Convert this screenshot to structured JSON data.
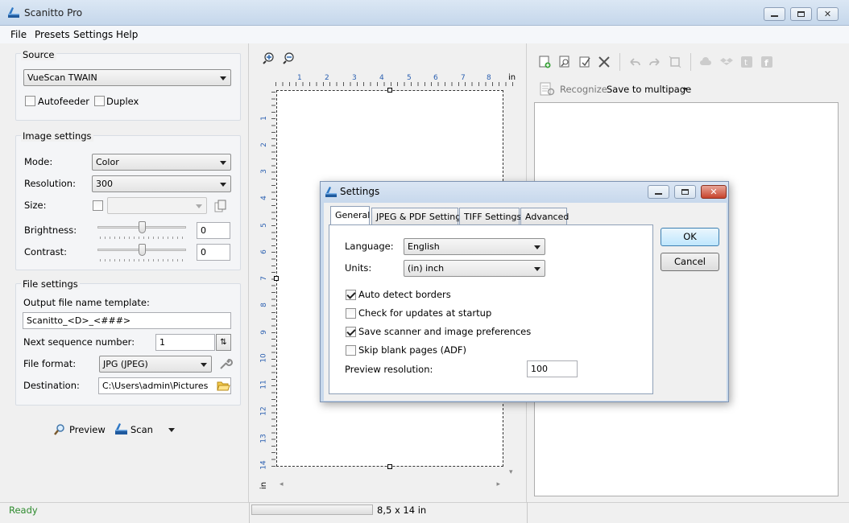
{
  "window": {
    "title": "Scanitto Pro"
  },
  "menu": [
    "File",
    "Presets",
    "Settings",
    "Help"
  ],
  "source": {
    "group_label": "Source",
    "device": "VueScan TWAIN",
    "autofeeder_label": "Autofeeder",
    "duplex_label": "Duplex"
  },
  "image_settings": {
    "group_label": "Image settings",
    "mode_label": "Mode:",
    "mode_value": "Color",
    "resolution_label": "Resolution:",
    "resolution_value": "300",
    "size_label": "Size:",
    "size_value": "",
    "brightness_label": "Brightness:",
    "brightness_value": "0",
    "contrast_label": "Contrast:",
    "contrast_value": "0"
  },
  "file_settings": {
    "group_label": "File settings",
    "template_label": "Output file name template:",
    "template_value": "Scanitto_<D>_<###>",
    "sequence_label": "Next sequence number:",
    "sequence_value": "1",
    "format_label": "File format:",
    "format_value": "JPG (JPEG)",
    "destination_label": "Destination:",
    "destination_value": "C:\\Users\\admin\\Pictures"
  },
  "actions": {
    "preview_label": "Preview",
    "scan_label": "Scan"
  },
  "ruler": {
    "unit": "in",
    "h_numbers": [
      "1",
      "2",
      "3",
      "4",
      "5",
      "6",
      "7",
      "8"
    ],
    "v_numbers": [
      "1",
      "2",
      "3",
      "4",
      "5",
      "6",
      "7",
      "8",
      "9",
      "10",
      "11",
      "12",
      "13",
      "14"
    ]
  },
  "right_toolbar": {
    "recognize_label": "Recognize",
    "save_multipage_label": "Save to multipage"
  },
  "status": {
    "text": "Ready",
    "page_size": "8,5 x 14 in",
    "progress": 0
  },
  "dialog": {
    "title": "Settings",
    "tabs": [
      "General",
      "JPEG & PDF Settings",
      "TIFF Settings",
      "Advanced"
    ],
    "active_tab": "General",
    "language_label": "Language:",
    "language_value": "English",
    "units_label": "Units:",
    "units_value": "(in) inch",
    "checkboxes": [
      {
        "label": "Auto detect borders",
        "checked": true
      },
      {
        "label": "Check for updates at startup",
        "checked": false
      },
      {
        "label": "Save scanner and image preferences",
        "checked": true
      },
      {
        "label": "Skip blank pages (ADF)",
        "checked": false
      }
    ],
    "preview_resolution_label": "Preview resolution:",
    "preview_resolution_value": "100",
    "ok_label": "OK",
    "cancel_label": "Cancel"
  },
  "colors": {
    "status_ready": "#2e8b2e",
    "ruler_text": "#2a5fb0",
    "accent": "#3c7fb1"
  }
}
